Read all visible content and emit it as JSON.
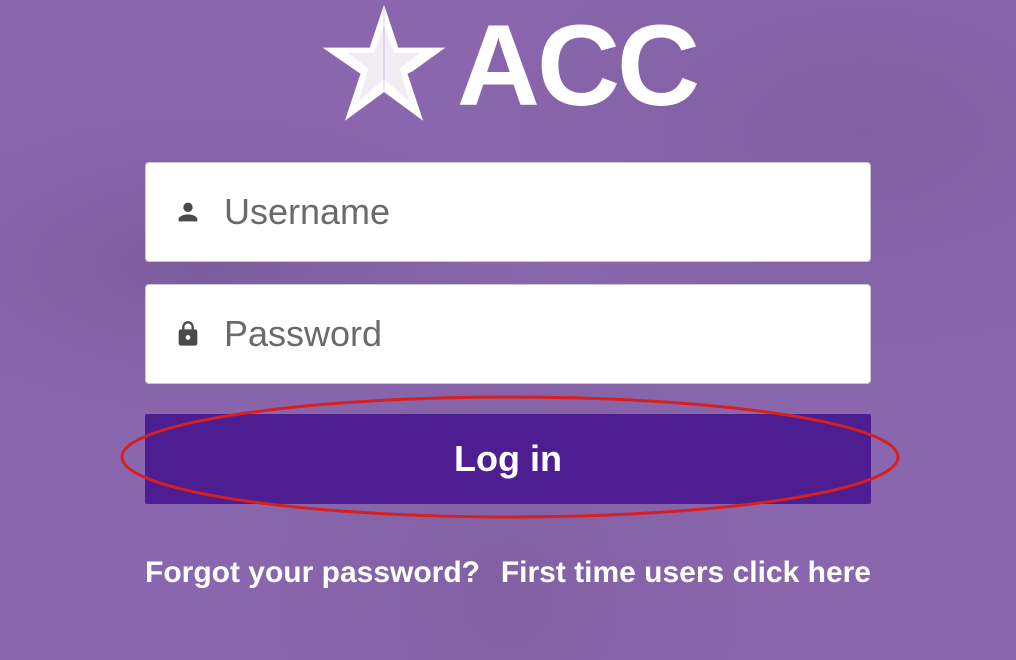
{
  "logo": {
    "text": "ACC",
    "icon_name": "star-icon"
  },
  "form": {
    "username_placeholder": "Username",
    "password_placeholder": "Password",
    "login_button_label": "Log in"
  },
  "links": {
    "forgot_password": "Forgot your password?",
    "first_time": "First time users click here"
  }
}
